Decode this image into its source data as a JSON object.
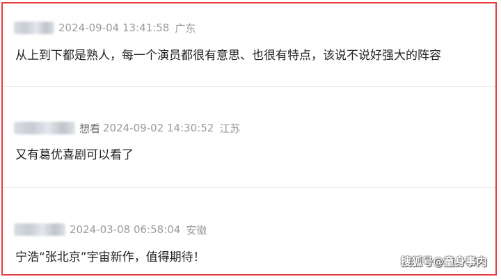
{
  "comments": [
    {
      "name_fragment": "",
      "timestamp": "2024-09-04 13:41:58",
      "location": "广东",
      "text": "从上到下都是熟人，每一个演员都很有意思、也很有特点，该说不说好强大的阵容"
    },
    {
      "name_fragment": "想看",
      "timestamp": "2024-09-02 14:30:52",
      "location": "江苏",
      "text": "又有葛优喜剧可以看了"
    },
    {
      "name_fragment": "",
      "timestamp": "2024-03-08 06:58:04",
      "location": "安徽",
      "text": "宁浩“张北京”宇宙新作，值得期待！"
    }
  ],
  "watermark": "搜狐号@童身事内",
  "colors": {
    "border": "#e63c3c",
    "meta": "#9a9a9a",
    "text": "#222222"
  }
}
